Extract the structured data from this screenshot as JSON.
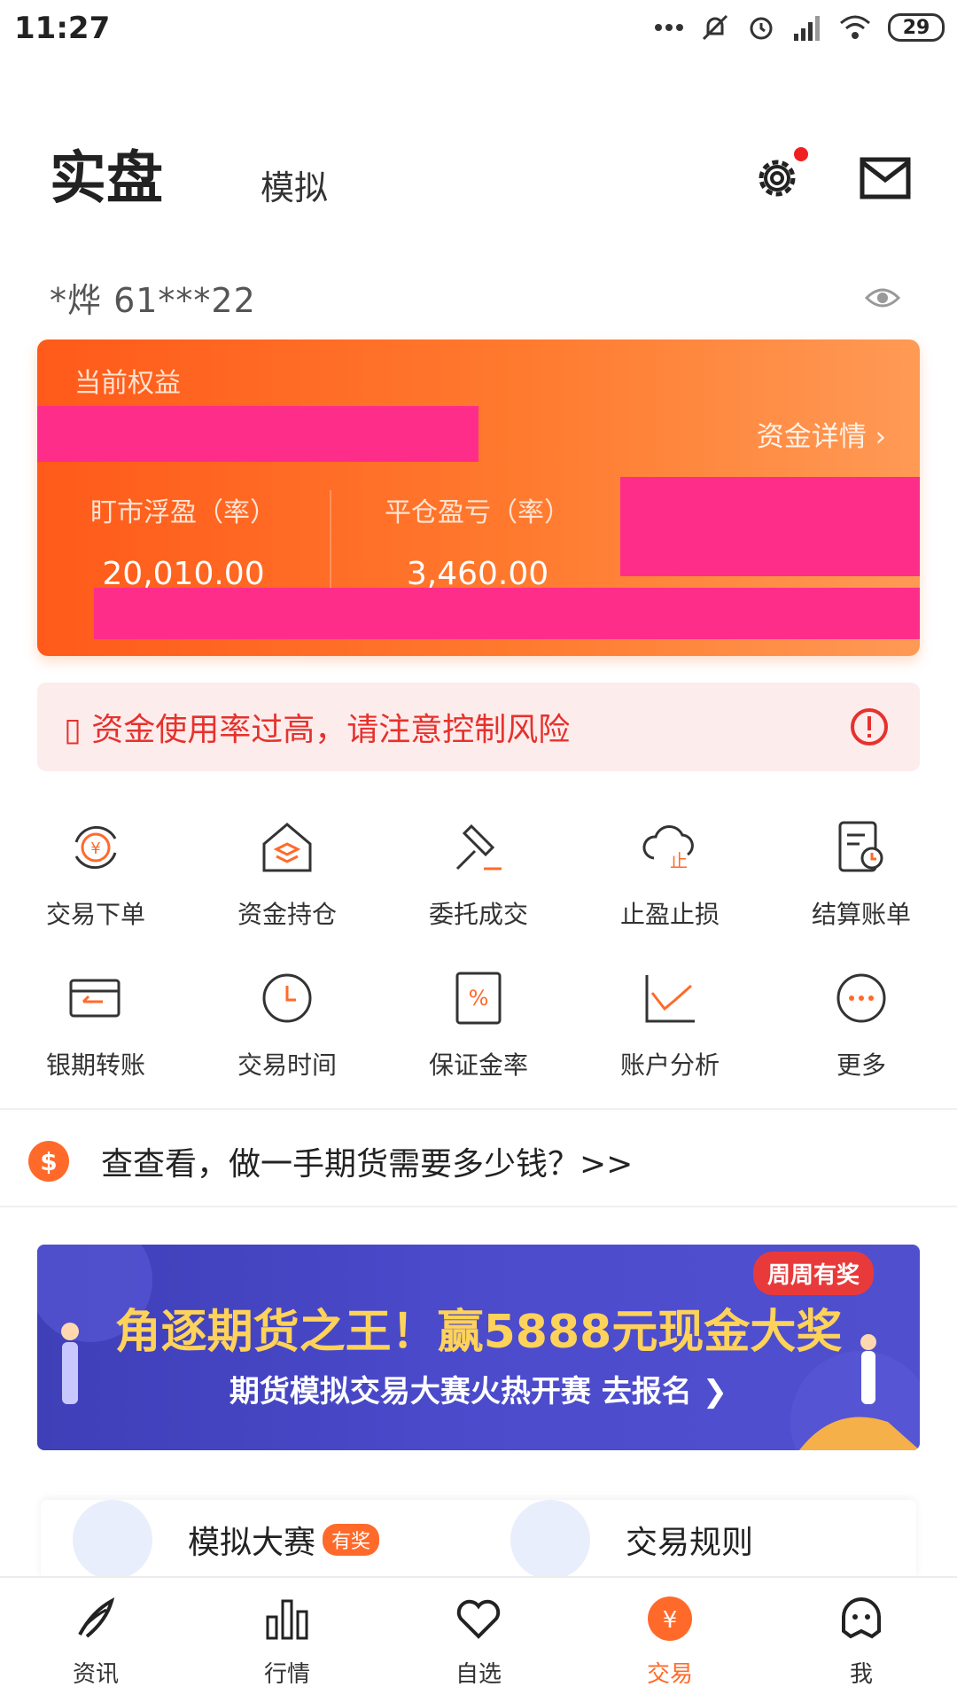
{
  "status_bar": {
    "time": "11:27",
    "battery": "29"
  },
  "header": {
    "tab_live": "实盘",
    "tab_sim": "模拟"
  },
  "account": {
    "name_masked": "*烨  61***22"
  },
  "equity_card": {
    "label": "当前权益",
    "funds_detail_link": "资金详情 ›",
    "floating_pnl_label": "盯市浮盈（率）",
    "floating_pnl_value": "20,010.00",
    "closed_pnl_label": "平仓盈亏（率）",
    "closed_pnl_value": "3,460.00"
  },
  "warning": {
    "text": "▯ 资金使用率过高，请注意控制风险"
  },
  "grid": {
    "row1": [
      {
        "label": "交易下单",
        "icon": "yuan-cycle-icon"
      },
      {
        "label": "资金持仓",
        "icon": "house-stack-icon"
      },
      {
        "label": "委托成交",
        "icon": "gavel-icon"
      },
      {
        "label": "止盈止损",
        "icon": "cloud-stop-icon"
      },
      {
        "label": "结算账单",
        "icon": "bill-clock-icon"
      }
    ],
    "row2": [
      {
        "label": "银期转账",
        "icon": "card-transfer-icon"
      },
      {
        "label": "交易时间",
        "icon": "clock-icon"
      },
      {
        "label": "保证金率",
        "icon": "percent-icon"
      },
      {
        "label": "账户分析",
        "icon": "line-chart-icon"
      },
      {
        "label": "更多",
        "icon": "more-dots-icon"
      }
    ]
  },
  "promo": {
    "icon_text": "$",
    "text": "查查看，做一手期货需要多少钱？>>"
  },
  "banner": {
    "badge": "周周有奖",
    "title": "角逐期货之王！赢5888元现金大奖",
    "subtitle": "期货模拟交易大赛火热开赛 去报名 ❯"
  },
  "cards": {
    "left_title": "模拟大赛",
    "left_badge": "有奖",
    "right_title": "交易规则"
  },
  "nav": {
    "items": [
      {
        "label": "资讯"
      },
      {
        "label": "行情"
      },
      {
        "label": "自选"
      },
      {
        "label": "交易"
      },
      {
        "label": "我"
      }
    ]
  },
  "colors": {
    "accent": "#ff6a2a",
    "warning": "#e5322d",
    "banner": "#4b4bcc"
  }
}
